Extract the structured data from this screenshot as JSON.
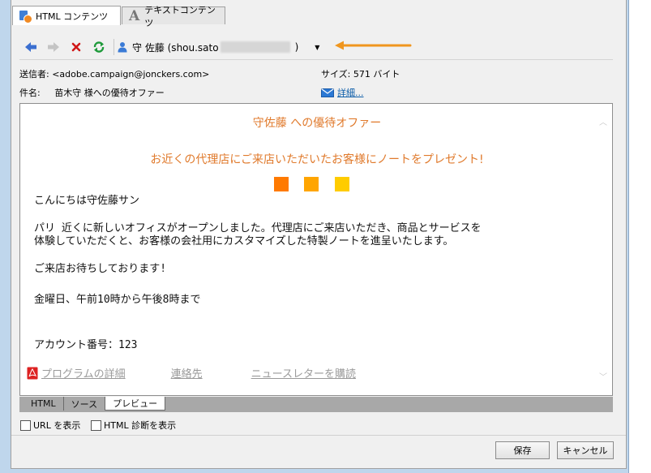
{
  "tabs": [
    {
      "label": "HTML コンテンツ",
      "active": true,
      "icon": "html-content-icon"
    },
    {
      "label": "テキストコンテンツ",
      "active": false,
      "icon": "text-content-icon"
    }
  ],
  "toolbar": {
    "user_label": "守 佐藤 (shou.sato",
    "user_close_paren": ")",
    "icons": [
      "back-arrow-icon",
      "forward-arrow-icon",
      "delete-icon",
      "refresh-icon",
      "user-icon",
      "chevron-down-icon"
    ]
  },
  "header": {
    "sender_label": "送信者:",
    "sender_value": "<adobe.campaign@jonckers.com>",
    "size_label": "サイズ:",
    "size_value": "571 バイト",
    "subject_label": "件名:",
    "subject_value": "苗木守 様への優待オファー",
    "details_link": "詳細..."
  },
  "preview": {
    "title": "守佐藤 への優待オファー",
    "subtitle": "お近くの代理店にご来店いただいたお客様にノートをプレゼント!",
    "squares": [
      "#ff7a00",
      "#ffa500",
      "#ffcc00"
    ],
    "greeting": "こんにちは守佐藤サン",
    "paragraph_line1": "パリ 近くに新しいオフィスがオープンしました。代理店にご来店いただき、商品とサービスを",
    "paragraph_line2": "体験していただくと、お客様の会社用にカスタマイズした特製ノートを進呈いたします。",
    "closing": "ご来店お待ちしております!",
    "hours": "金曜日、午前10時から午後8時まで",
    "account": "アカウント番号：123",
    "links": [
      "プログラムの詳細",
      "連絡先",
      "ニュースレターを購読"
    ],
    "title_color": "#e07a2c"
  },
  "view_tabs": [
    {
      "label": "HTML",
      "active": false
    },
    {
      "label": "ソース",
      "active": false
    },
    {
      "label": "プレビュー",
      "active": true
    }
  ],
  "options": {
    "show_url": "URL を表示",
    "show_html_diag": "HTML 診断を表示"
  },
  "buttons": {
    "save": "保存",
    "cancel": "キャンセル"
  }
}
